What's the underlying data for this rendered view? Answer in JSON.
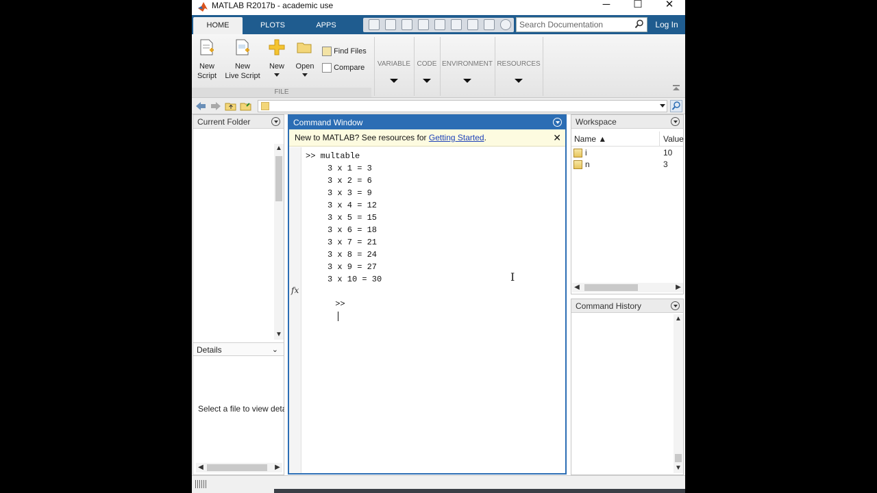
{
  "window": {
    "title": "MATLAB R2017b - academic use",
    "controls": {
      "minimize": "─",
      "maximize": "☐",
      "close": "✕"
    }
  },
  "ribbon": {
    "tabs": [
      "HOME",
      "PLOTS",
      "APPS"
    ],
    "active_tab": "HOME",
    "search_placeholder": "Search Documentation",
    "login_label": "Log In",
    "file_buttons": {
      "new_script": [
        "New",
        "Script"
      ],
      "new_live_script": [
        "New",
        "Live Script"
      ],
      "new": "New",
      "open": "Open",
      "find_files": "Find Files",
      "compare": "Compare"
    },
    "file_section_label": "FILE",
    "sections": [
      "VARIABLE",
      "CODE",
      "ENVIRONMENT",
      "RESOURCES"
    ]
  },
  "current_folder": {
    "title": "Current Folder",
    "details_title": "Details",
    "details_message": "Select a file to view deta"
  },
  "command_window": {
    "title": "Command Window",
    "notice_prefix": "New to MATLAB? See resources for ",
    "notice_link": "Getting Started",
    "notice_suffix": ".",
    "notice_close": "✕",
    "command": ">> multable",
    "output": [
      "3 x 1 = 3",
      "3 x 2 = 6",
      "3 x 3 = 9",
      "3 x 4 = 12",
      "3 x 5 = 15",
      "3 x 6 = 18",
      "3 x 7 = 21",
      "3 x 8 = 24",
      "3 x 9 = 27",
      "3 x 10 = 30"
    ],
    "prompt": ">>",
    "fx_label": "fx"
  },
  "workspace": {
    "title": "Workspace",
    "columns": [
      "Name ▲",
      "Value"
    ],
    "variables": [
      {
        "name": "i",
        "value": "10"
      },
      {
        "name": "n",
        "value": "3"
      }
    ]
  },
  "command_history": {
    "title": "Command History"
  },
  "colors": {
    "accent": "#1f5c8f",
    "active_border": "#2b6db4",
    "notice_bg": "#fdfbe0",
    "link": "#1b3fb8"
  }
}
